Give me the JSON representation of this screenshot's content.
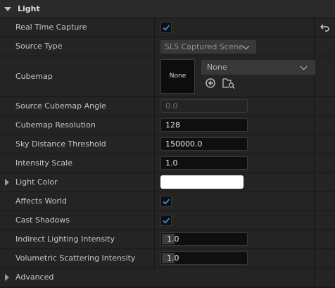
{
  "section": {
    "title": "Light"
  },
  "rows": {
    "real_time_capture": {
      "label": "Real Time Capture",
      "checked": true
    },
    "source_type": {
      "label": "Source Type",
      "value": "SLS Captured Scene"
    },
    "cubemap": {
      "label": "Cubemap",
      "thumb_text": "None",
      "asset_value": "None"
    },
    "source_cubemap_angle": {
      "label": "Source Cubemap Angle",
      "value": "0.0"
    },
    "cubemap_resolution": {
      "label": "Cubemap Resolution",
      "value": "128"
    },
    "sky_distance_threshold": {
      "label": "Sky Distance Threshold",
      "value": "150000.0"
    },
    "intensity_scale": {
      "label": "Intensity Scale",
      "value": "1.0"
    },
    "light_color": {
      "label": "Light Color",
      "color": "#ffffff"
    },
    "affects_world": {
      "label": "Affects World",
      "checked": true
    },
    "cast_shadows": {
      "label": "Cast Shadows",
      "checked": true
    },
    "indirect_lighting_intensity": {
      "label": "Indirect Lighting Intensity",
      "value": "1.0"
    },
    "volumetric_scattering_intensity": {
      "label": "Volumetric Scattering Intensity",
      "value": "1.0"
    },
    "advanced": {
      "label": "Advanced"
    }
  },
  "colors": {
    "accent_check": "#2f86d6",
    "panel_bg": "#242424",
    "header_bg": "#2a2a2a"
  },
  "icons": [
    "collapse-arrow-icon",
    "expand-arrow-icon",
    "checkmark-icon",
    "reset-to-default-icon",
    "use-selected-asset-icon",
    "browse-to-asset-icon",
    "chevron-down-icon"
  ]
}
